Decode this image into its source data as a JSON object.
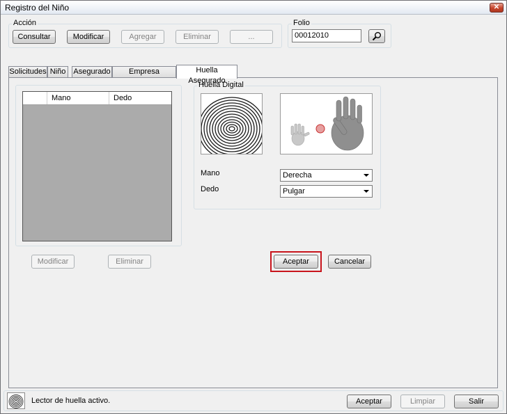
{
  "window": {
    "title": "Registro del Niño",
    "close_glyph": "✕"
  },
  "accion": {
    "label": "Acción",
    "buttons": [
      {
        "label": "Consultar"
      },
      {
        "label": "Modificar"
      },
      {
        "label": "Agregar"
      },
      {
        "label": "Eliminar"
      },
      {
        "label": "..."
      }
    ]
  },
  "folio": {
    "label": "Folio",
    "value": "00012010",
    "search_icon": "magnifier-icon"
  },
  "tabs": [
    {
      "label": "Solicitudes"
    },
    {
      "label": "Niño"
    },
    {
      "label": "Asegurado"
    },
    {
      "label": "Empresa Asegurado"
    },
    {
      "label": "Huella Asegurado"
    }
  ],
  "grid": {
    "columns": [
      {
        "label": "Mano"
      },
      {
        "label": "Dedo"
      }
    ]
  },
  "grid_buttons": {
    "modificar": "Modificar",
    "eliminar": "Eliminar"
  },
  "huella": {
    "group_label": "Huella Digital",
    "mano_label": "Mano",
    "mano_value": "Derecha",
    "dedo_label": "Dedo",
    "dedo_value": "Pulgar"
  },
  "actions": {
    "aceptar": "Aceptar",
    "cancelar": "Cancelar",
    "highlight_color": "#c8141c"
  },
  "status": {
    "text": "Lector de huella activo.",
    "aceptar": "Aceptar",
    "limpiar": "Limpiar",
    "salir": "Salir"
  }
}
